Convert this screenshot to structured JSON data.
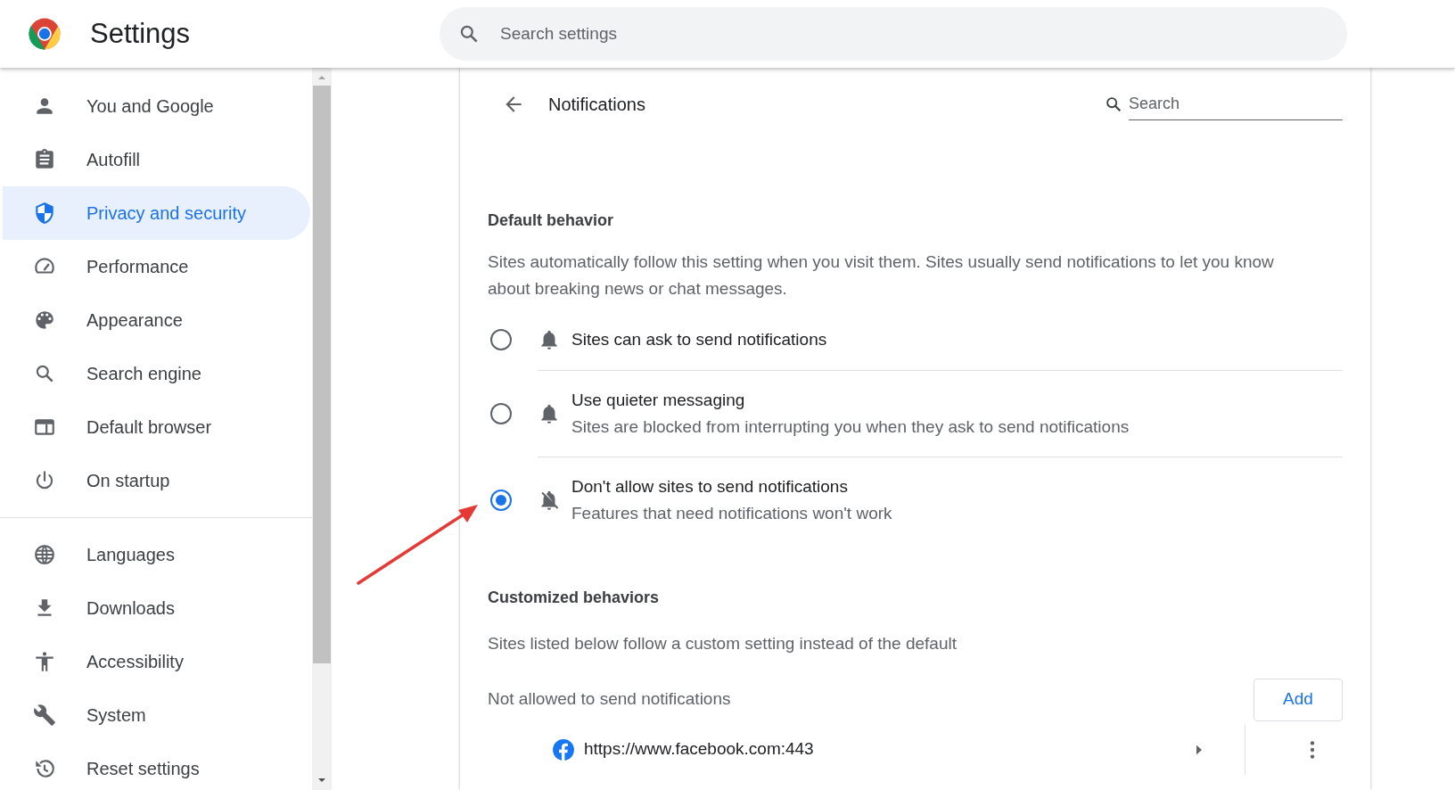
{
  "header": {
    "title": "Settings",
    "search": {
      "placeholder": "Search settings"
    }
  },
  "sidebar": {
    "groups": [
      {
        "items": [
          {
            "label": "You and Google",
            "selected": false
          },
          {
            "label": "Autofill",
            "selected": false
          },
          {
            "label": "Privacy and security",
            "selected": true
          },
          {
            "label": "Performance",
            "selected": false
          },
          {
            "label": "Appearance",
            "selected": false
          },
          {
            "label": "Search engine",
            "selected": false
          },
          {
            "label": "Default browser",
            "selected": false
          },
          {
            "label": "On startup",
            "selected": false
          }
        ]
      },
      {
        "items": [
          {
            "label": "Languages",
            "selected": false
          },
          {
            "label": "Downloads",
            "selected": false
          },
          {
            "label": "Accessibility",
            "selected": false
          },
          {
            "label": "System",
            "selected": false
          },
          {
            "label": "Reset settings",
            "selected": false
          }
        ]
      }
    ]
  },
  "page": {
    "title": "Notifications",
    "search": {
      "placeholder": "Search"
    },
    "default_behavior": {
      "heading": "Default behavior",
      "description": "Sites automatically follow this setting when you visit them. Sites usually send notifications to let you know about breaking news or chat messages.",
      "options": [
        {
          "label": "Sites can ask to send notifications",
          "selected": false
        },
        {
          "label": "Use quieter messaging",
          "description": "Sites are blocked from interrupting you when they ask to send notifications",
          "selected": false
        },
        {
          "label": "Don't allow sites to send notifications",
          "description": "Features that need notifications won't work",
          "selected": true
        }
      ]
    },
    "customized": {
      "heading": "Customized behaviors",
      "description": "Sites listed below follow a custom setting instead of the default",
      "blocked": {
        "label": "Not allowed to send notifications",
        "add_button": "Add",
        "sites": [
          {
            "url": "https://www.facebook.com:443"
          }
        ]
      }
    }
  }
}
